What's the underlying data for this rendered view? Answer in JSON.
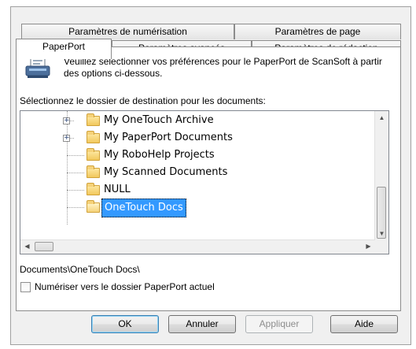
{
  "tabs_row1": [
    {
      "label": "Paramètres de numérisation"
    },
    {
      "label": "Paramètres de page"
    }
  ],
  "tabs_row2": [
    {
      "label": "PaperPort",
      "active": true
    },
    {
      "label": "Paramètres avancés"
    },
    {
      "label": "Paramètres de rédaction"
    }
  ],
  "intro_text": "Veuillez sélectionner vos préférences pour le PaperPort de ScanSoft à partir des options ci-dessous.",
  "destination_label": "Sélectionnez le dossier de destination pour les documents:",
  "tree": [
    {
      "label": "My OneTouch Archive",
      "expandable": true
    },
    {
      "label": "My PaperPort Documents",
      "expandable": true
    },
    {
      "label": "My RoboHelp Projects",
      "expandable": false
    },
    {
      "label": "My Scanned Documents",
      "expandable": false
    },
    {
      "label": "NULL",
      "expandable": false
    },
    {
      "label": "OneTouch Docs",
      "expandable": false,
      "selected": true,
      "open": true
    }
  ],
  "selected_path": "Documents\\OneTouch Docs\\",
  "checkbox_label": "Numériser vers le dossier PaperPort actuel",
  "checkbox_checked": false,
  "buttons": {
    "ok": "OK",
    "cancel": "Annuler",
    "apply": "Appliquer",
    "help": "Aide"
  },
  "colors": {
    "selection": "#3399ff",
    "folder": "#f2c85c",
    "default_button_border": "#3c7fb1"
  }
}
